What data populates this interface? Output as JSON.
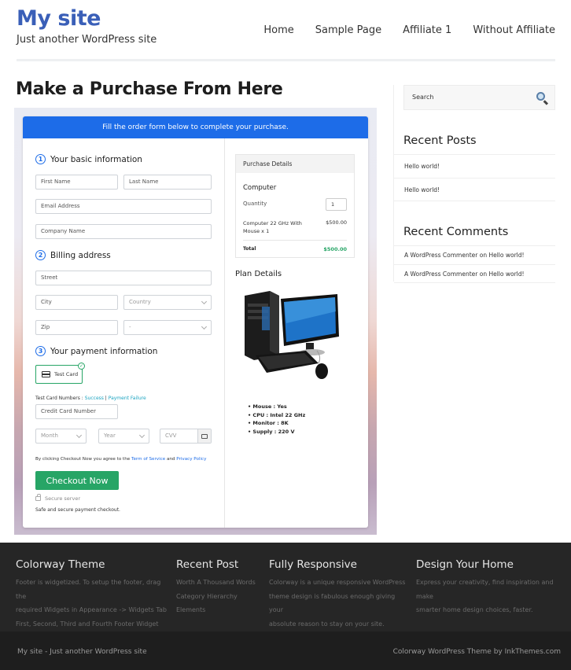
{
  "header": {
    "site_title": "My site",
    "tagline": "Just another WordPress site",
    "nav": [
      "Home",
      "Sample Page",
      "Affiliate 1",
      "Without Affiliate"
    ]
  },
  "main": {
    "page_title": "Make a Purchase From Here",
    "banner": "Fill the order form below to complete your purchase.",
    "sections": {
      "basic": {
        "number": "1",
        "title": "Your basic information"
      },
      "billing": {
        "number": "2",
        "title": "Billing address"
      },
      "payment": {
        "number": "3",
        "title": "Your payment information"
      }
    },
    "fields": {
      "first_name": "First Name",
      "last_name": "Last Name",
      "email": "Email Address",
      "company": "Company Name",
      "street": "Street",
      "city": "City",
      "country": "Country",
      "zip": "Zip",
      "state": "-",
      "card_number": "Credit Card Number",
      "month": "Month",
      "year": "Year",
      "cvv": "CVV"
    },
    "payment_method": "Test Card",
    "test_cards": {
      "label": "Test Card Numbers : ",
      "success": "Success",
      "separator": " | ",
      "failure": "Payment Failure"
    },
    "terms": {
      "prefix": "By clicking Checkout Now you agree to the ",
      "tos": "Term of Service",
      "and": " and ",
      "privacy": "Privacy Policy"
    },
    "checkout_label": "Checkout Now",
    "secure_server": "Secure server",
    "safe_text": "Safe and secure payment checkout.",
    "purchase": {
      "heading": "Purchase Details",
      "item": "Computer",
      "quantity_label": "Quantity",
      "quantity": "1",
      "description": "Computer 22 GHz With Mouse x 1",
      "price": "$500.00",
      "total_label": "Total",
      "total": "$500.00"
    },
    "plan": {
      "title": "Plan Details",
      "specs": [
        "Mouse : Yes",
        "CPU : Intel 22 GHz",
        "Monitor : 8K",
        "Supply : 220 V"
      ]
    }
  },
  "sidebar": {
    "search_placeholder": "Search",
    "recent_posts_title": "Recent Posts",
    "recent_posts": [
      "Hello world!",
      "Hello world!"
    ],
    "recent_comments_title": "Recent Comments",
    "recent_comments": [
      "A WordPress Commenter on Hello world!",
      "A WordPress Commenter on Hello world!"
    ]
  },
  "footer": {
    "columns": [
      {
        "title": "Colorway Theme",
        "text": [
          "Footer is widgetized. To setup the footer, drag the",
          "required Widgets in Appearance -> Widgets Tab",
          "First, Second, Third and Fourth Footer Widget"
        ]
      },
      {
        "title": "Recent Post",
        "text": [
          "Worth A Thousand Words",
          "Category Hierarchy",
          "Elements"
        ]
      },
      {
        "title": "Fully Responsive",
        "text": [
          "Colorway is a unique responsive WordPress",
          "theme design is fabulous enough giving your",
          "absolute reason to stay on your site."
        ]
      },
      {
        "title": "Design Your Home",
        "text": [
          "Express your creativity, find inspiration and make",
          "smarter home design choices, faster."
        ]
      }
    ],
    "bottom_left": "My site - Just another WordPress site",
    "bottom_right": "Colorway WordPress Theme by InkThemes.com"
  },
  "colors": {
    "brand": "#3a5fb8",
    "banner": "#1d6ce8",
    "checkout": "#27a566",
    "footer": "#262626"
  }
}
